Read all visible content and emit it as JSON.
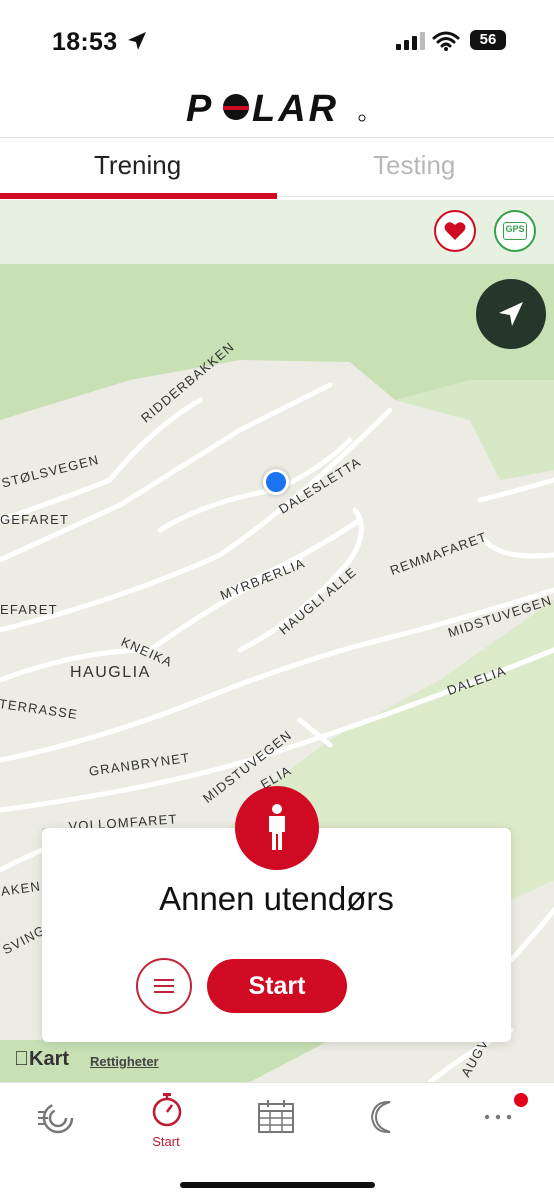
{
  "status_bar": {
    "time": "18:53",
    "battery": "56"
  },
  "header": {
    "brand": "POLAR"
  },
  "tabs": [
    {
      "label": "Trening",
      "active": true
    },
    {
      "label": "Testing",
      "active": false
    }
  ],
  "sensors": {
    "heart_rate_icon": "heart-icon",
    "gps_label": "GPS"
  },
  "map": {
    "streets": {
      "ridderbakken": "RIDDERBAKKEN",
      "stolsvegen": "STØLSVEGEN",
      "gefaret": "GEFARET",
      "dalesletta": "DALESLETTA",
      "remmafaret": "REMMAFARET",
      "myrbaerlia": "MYRBÆRLIA",
      "haugli_alle": "HAUGLI ALLE",
      "efaret": "EFARET",
      "midstuvegen_upper": "MIDSTUVEGEN",
      "kneika": "KNEIKA",
      "dalelia": "DALELIA",
      "haugliа_area": "HAUGLIA",
      "terrasse": "TERRASSE",
      "granbrynet": "GRANBRYNET",
      "midstuvegen_lower": "MIDSTUVEGEN",
      "elia": "ELIA",
      "vollomfaret": "VOLLOMFARET",
      "aken": "AKEN",
      "svingr": "SVINGR",
      "augv": "AUGV"
    },
    "attribution": "Kart",
    "rights_link": "Rettigheter"
  },
  "activity": {
    "name": "Annen utendørs",
    "start_label": "Start"
  },
  "bottom_nav": {
    "start_label": "Start"
  },
  "colors": {
    "accent": "#d10a24",
    "gps": "#35a24a",
    "map_green": "#c8e0b4",
    "map_residential": "#ecebe4"
  }
}
